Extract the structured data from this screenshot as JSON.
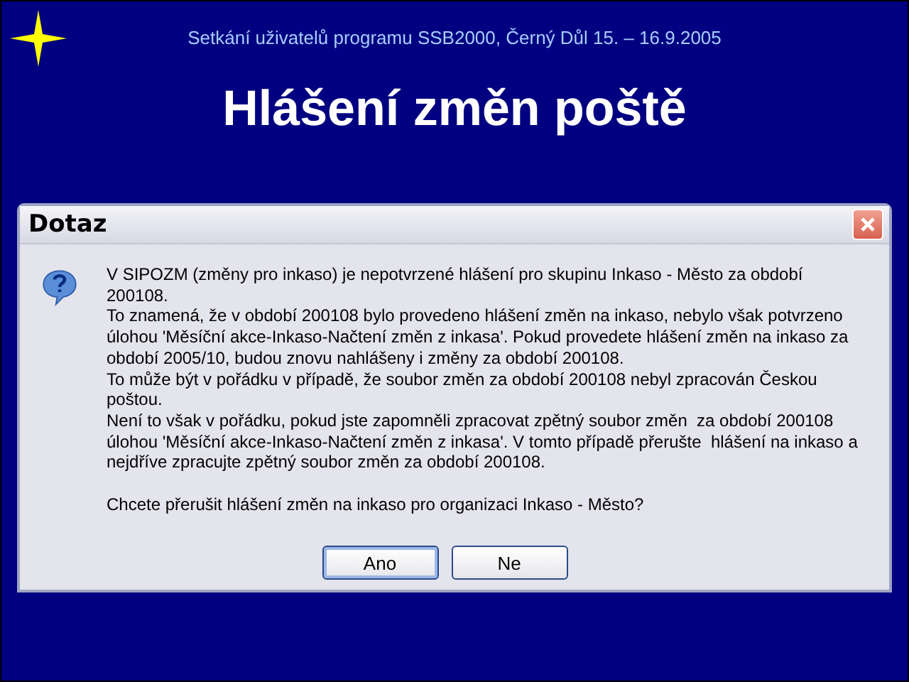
{
  "slide": {
    "subtitle": "Setkání uživatelů programu SSB2000, Černý Důl 15. – 16.9.2005",
    "title": "Hlášení změn poště"
  },
  "dialog": {
    "title": "Dotaz",
    "message_lines": [
      "V SIPOZM (změny pro inkaso) je nepotvrzené hlášení pro skupinu Inkaso - Město za období",
      "200108.",
      "To znamená, že v období 200108 bylo provedeno hlášení změn na inkaso, nebylo však potvrzeno",
      "úlohou 'Měsíční akce-Inkaso-Načtení změn z inkasa'. Pokud provedete hlášení změn na inkaso za",
      "období 2005/10, budou znovu nahlášeny i změny za období 200108.",
      "To může být v pořádku v případě, že soubor změn za období 200108 nebyl zpracován Českou",
      "poštou.",
      "Není to však v pořádku, pokud jste zapomněli zpracovat zpětný soubor změn  za období 200108",
      "úlohou 'Měsíční akce-Inkaso-Načtení změn z inkasa'. V tomto případě přerušte  hlášení na inkaso a",
      "nejdříve zpracujte zpětný soubor změn za období 200108."
    ],
    "question": "Chcete přerušit hlášení změn na inkaso pro organizaci Inkaso - Město?",
    "buttons": [
      {
        "label": "Ano",
        "default": true
      },
      {
        "label": "Ne",
        "default": false
      }
    ]
  }
}
